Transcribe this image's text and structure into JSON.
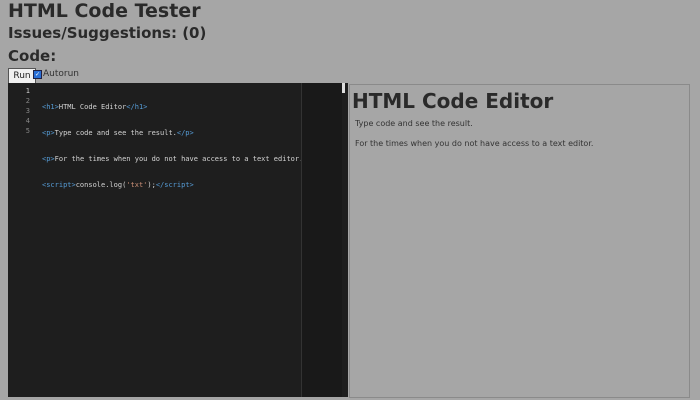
{
  "header": {
    "title": "HTML Code Tester",
    "issues": "Issues/Suggestions: (0)",
    "code_label": "Code:"
  },
  "toolbar": {
    "run_label": "Run",
    "autorun_label": "Autorun",
    "autorun_checked": true
  },
  "editor": {
    "line_numbers": [
      "1",
      "2",
      "3",
      "4",
      "5"
    ]
  },
  "preview": {
    "heading": "HTML Code Editor",
    "p1": "Type code and see the result.",
    "p2": "For the times when you do not have access to a text editor."
  }
}
